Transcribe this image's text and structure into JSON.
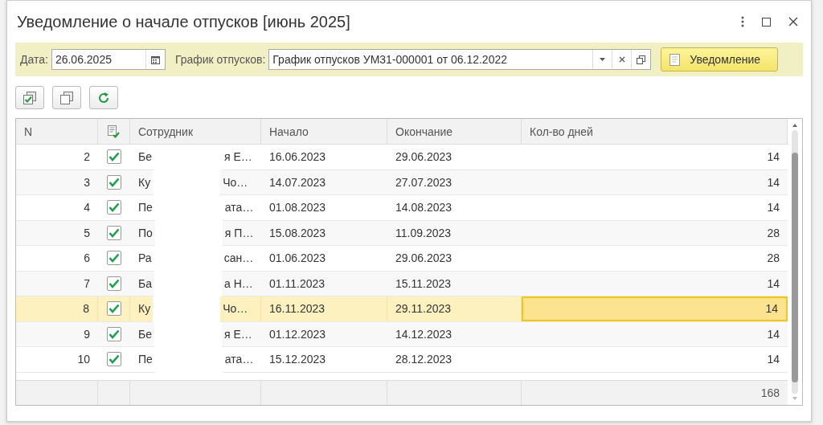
{
  "window": {
    "title": "Уведомление о начале отпусков [июнь 2025]"
  },
  "filter": {
    "date_label": "Дата:",
    "date_value": "26.06.2025",
    "schedule_label": "График отпусков:",
    "schedule_value": "График отпусков УМ31-000001 от 06.12.2022",
    "notify_button": "Уведомление"
  },
  "table": {
    "columns": [
      "N",
      "Сотрудник",
      "Начало",
      "Окончание",
      "Кол-во дней"
    ],
    "rows": [
      {
        "n": "2",
        "checked": true,
        "name_start": "Бе",
        "name_end": "я Е…",
        "start": "16.06.2023",
        "end": "29.06.2023",
        "days": "14",
        "selected": false
      },
      {
        "n": "3",
        "checked": true,
        "name_start": "Ку",
        "name_end": "Чо…",
        "start": "14.07.2023",
        "end": "27.07.2023",
        "days": "14",
        "selected": false
      },
      {
        "n": "4",
        "checked": true,
        "name_start": "Пе",
        "name_end": "ата…",
        "start": "01.08.2023",
        "end": "14.08.2023",
        "days": "14",
        "selected": false
      },
      {
        "n": "5",
        "checked": true,
        "name_start": "По",
        "name_end": "я П…",
        "start": "15.08.2023",
        "end": "11.09.2023",
        "days": "28",
        "selected": false
      },
      {
        "n": "6",
        "checked": true,
        "name_start": "Ра",
        "name_end": "сан…",
        "start": "01.06.2023",
        "end": "29.06.2023",
        "days": "28",
        "selected": false
      },
      {
        "n": "7",
        "checked": true,
        "name_start": "Ба",
        "name_end": "а Н…",
        "start": "01.11.2023",
        "end": "15.11.2023",
        "days": "14",
        "selected": false
      },
      {
        "n": "8",
        "checked": true,
        "name_start": "Ку",
        "name_end": "Чо…",
        "start": "16.11.2023",
        "end": "29.11.2023",
        "days": "14",
        "selected": true
      },
      {
        "n": "9",
        "checked": true,
        "name_start": "Бе",
        "name_end": "я Е…",
        "start": "01.12.2023",
        "end": "14.12.2023",
        "days": "14",
        "selected": false
      },
      {
        "n": "10",
        "checked": true,
        "name_start": "Пе",
        "name_end": "ата…",
        "start": "15.12.2023",
        "end": "28.12.2023",
        "days": "14",
        "selected": false
      }
    ],
    "total_days": "168"
  }
}
